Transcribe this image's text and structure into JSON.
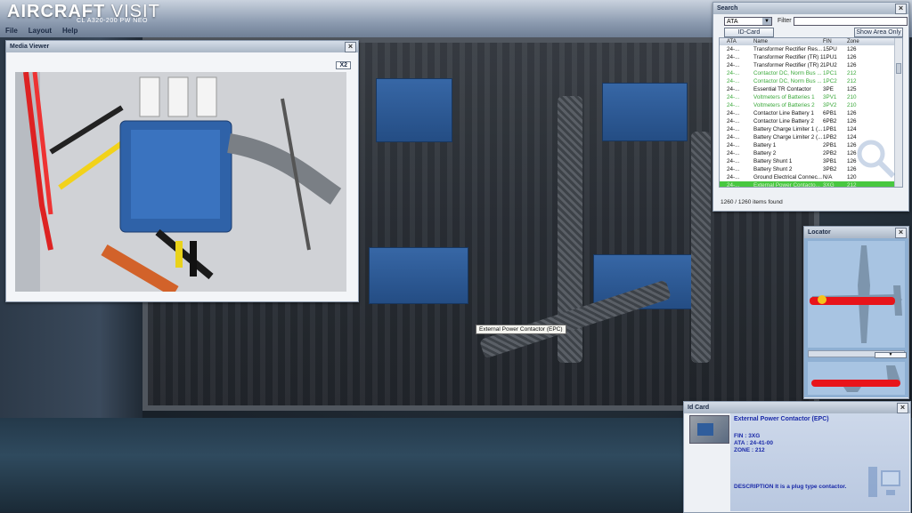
{
  "app": {
    "brand_bold": "AIRCRAFT",
    "brand_light": " VISIT",
    "model": "CL A320-200 PW NEO"
  },
  "menu": [
    "File",
    "Layout",
    "Help"
  ],
  "media_viewer": {
    "title": "Media Viewer",
    "close": "×",
    "zoom_button": "X2"
  },
  "search": {
    "title": "Search",
    "close": "×",
    "filter_mode": "ATA",
    "filter_label": "Filter :",
    "filter_value": "",
    "id_card_button": "ID-Card",
    "show_area_button": "Show Area Only",
    "columns": [
      "ATA",
      "Name",
      "FIN",
      "Zone"
    ],
    "rows": [
      {
        "ata": "24-...",
        "name": "Transformer Rectifier Res...",
        "fin": "15PU",
        "zone": "126",
        "style": "normal"
      },
      {
        "ata": "24-...",
        "name": "Transformer Rectifier (TR) 1",
        "fin": "1PU1",
        "zone": "126",
        "style": "normal"
      },
      {
        "ata": "24-...",
        "name": "Transformer Rectifier (TR) 2",
        "fin": "1PU2",
        "zone": "126",
        "style": "normal"
      },
      {
        "ata": "24-...",
        "name": "Contactor DC, Norm Bus ...",
        "fin": "1PC1",
        "zone": "212",
        "style": "green"
      },
      {
        "ata": "24-...",
        "name": "Contactor DC, Norm Bus ...",
        "fin": "1PC2",
        "zone": "212",
        "style": "green"
      },
      {
        "ata": "24-...",
        "name": "Essential TR Contactor",
        "fin": "3PE",
        "zone": "125",
        "style": "normal"
      },
      {
        "ata": "24-...",
        "name": "Voltmeters of Batteries 1",
        "fin": "3PV1",
        "zone": "210",
        "style": "green"
      },
      {
        "ata": "24-...",
        "name": "Voltmeters of Batteries 2",
        "fin": "3PV2",
        "zone": "210",
        "style": "green"
      },
      {
        "ata": "24-...",
        "name": "Contactor Line Battery 1",
        "fin": "6PB1",
        "zone": "126",
        "style": "normal"
      },
      {
        "ata": "24-...",
        "name": "Contactor Line Battery 2",
        "fin": "6PB2",
        "zone": "126",
        "style": "normal"
      },
      {
        "ata": "24-...",
        "name": "Battery Charge Limiter 1 (...",
        "fin": "1PB1",
        "zone": "124",
        "style": "normal"
      },
      {
        "ata": "24-...",
        "name": "Battery Charge Limiter 2 (...",
        "fin": "1PB2",
        "zone": "124",
        "style": "normal"
      },
      {
        "ata": "24-...",
        "name": "Battery 1",
        "fin": "2PB1",
        "zone": "126",
        "style": "normal"
      },
      {
        "ata": "24-...",
        "name": "Battery 2",
        "fin": "2PB2",
        "zone": "126",
        "style": "normal"
      },
      {
        "ata": "24-...",
        "name": "Battery Shunt 1",
        "fin": "3PB1",
        "zone": "126",
        "style": "normal"
      },
      {
        "ata": "24-...",
        "name": "Battery Shunt 2",
        "fin": "3PB2",
        "zone": "126",
        "style": "normal"
      },
      {
        "ata": "24-...",
        "name": "Ground Electrical Connec...",
        "fin": "N/A",
        "zone": "120",
        "style": "normal"
      },
      {
        "ata": "24-...",
        "name": "External Power Contacto...",
        "fin": "3XG",
        "zone": "212",
        "style": "sel"
      }
    ],
    "items_found": "1260 / 1260 items found"
  },
  "locator": {
    "title": "Locator",
    "close": "×"
  },
  "id_card": {
    "title": "Id Card",
    "close": "×",
    "name": "External Power Contactor (EPC)",
    "fin": "FIN : 3XG",
    "ata": "ATA : 24-41-00",
    "zone": "ZONE : 212",
    "description": "DESCRIPTION It is a plug type contactor."
  },
  "tooltip": "External Power Contactor (EPC)"
}
